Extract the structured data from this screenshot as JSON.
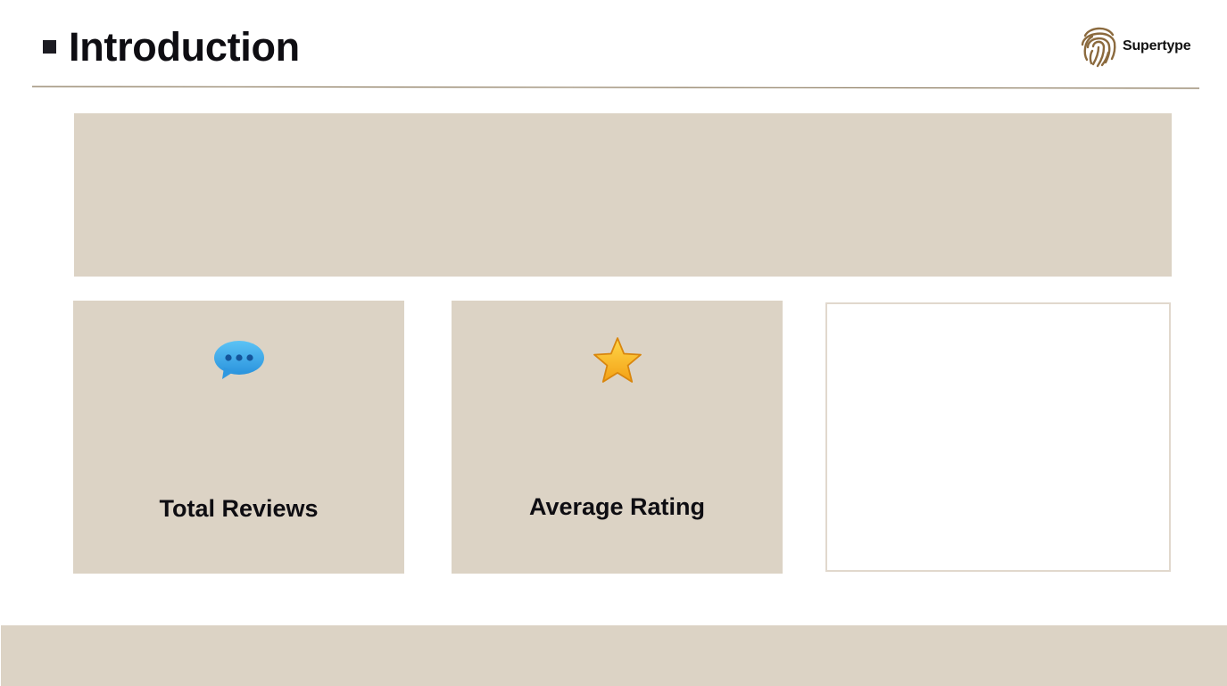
{
  "header": {
    "title": "Introduction",
    "logo_text": "Supertype"
  },
  "cards": [
    {
      "icon": "speech-bubble-icon",
      "label": "Total Reviews"
    },
    {
      "icon": "star-icon",
      "label": "Average Rating"
    },
    {
      "label": ""
    }
  ],
  "colors": {
    "accent_beige": "#dcd3c5",
    "title_text": "#0e0d12",
    "logo_brown": "#8b6a3e",
    "divider": "#8b7a5e",
    "empty_card_border": "#e1d8cd"
  }
}
